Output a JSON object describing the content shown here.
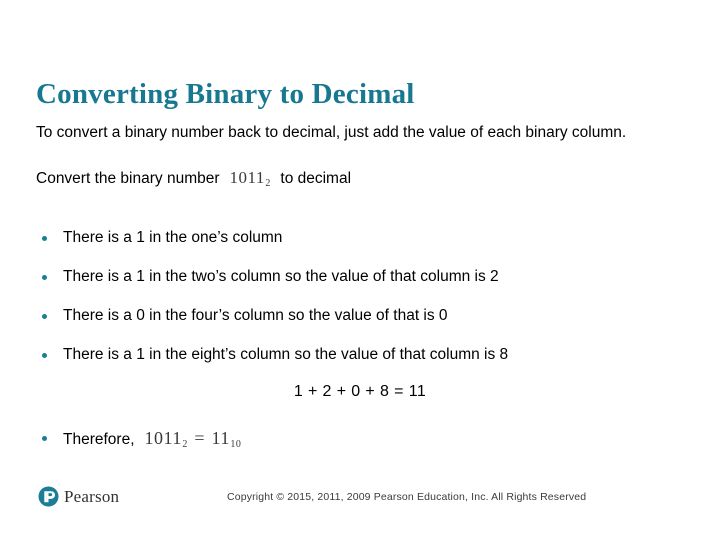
{
  "slide": {
    "title": "Converting Binary to Decimal",
    "title_color": "#17788f",
    "accent_color": "#1b7e96",
    "background_color": "#ffffff"
  },
  "body": {
    "intro_paragraph": "To convert a binary number back to decimal, just add the value of each binary column.",
    "prompt_prefix": "Convert the binary number",
    "prompt_math": {
      "base_digits": "1011",
      "subscript": "2"
    },
    "prompt_suffix": "to decimal"
  },
  "bullets": [
    {
      "text": "There is a 1 in the one’s column"
    },
    {
      "text": "There is a 1 in the two’s column so the value of that column is 2"
    },
    {
      "text": "There is a 0 in the four’s column so the value of that is 0"
    },
    {
      "text": "There is a 1 in the eight’s column so the value of that column is 8"
    }
  ],
  "sum_line": "1 + 2 + 0 + 8 = 11",
  "conclusion": {
    "label": "Therefore,",
    "binary_digits": "1011",
    "binary_subscript": "2",
    "equals": "=",
    "decimal_digits": "11",
    "decimal_subscript": "10"
  },
  "footer": {
    "logo_word": "Pearson",
    "logo_letter": "P",
    "logo_color": "#1b7e96",
    "copyright": "Copyright © 2015, 2011, 2009 Pearson Education, Inc. All Rights Reserved"
  }
}
